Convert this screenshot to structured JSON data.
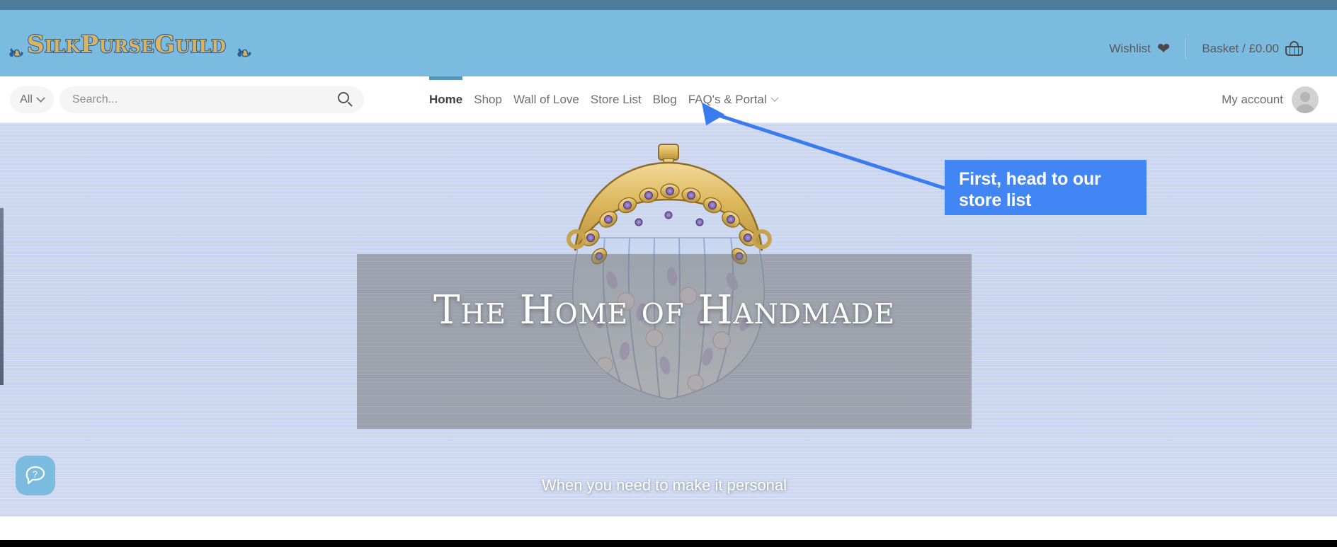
{
  "site": {
    "logo_text": "SilkPurseGuild",
    "logo_flourish_left": "❧",
    "logo_flourish_right": "❧"
  },
  "header": {
    "wishlist_label": "Wishlist",
    "wishlist_icon": "heart-icon",
    "basket_label": "Basket / £0.00",
    "basket_icon": "basket-icon"
  },
  "search": {
    "scope_label": "All",
    "scope_icon": "chevron-down-icon",
    "placeholder": "Search...",
    "value": "",
    "submit_icon": "search-icon"
  },
  "nav": {
    "items": [
      {
        "label": "Home",
        "active": true,
        "has_dropdown": false
      },
      {
        "label": "Shop",
        "active": false,
        "has_dropdown": false
      },
      {
        "label": "Wall of Love",
        "active": false,
        "has_dropdown": false
      },
      {
        "label": "Store List",
        "active": false,
        "has_dropdown": false
      },
      {
        "label": "Blog",
        "active": false,
        "has_dropdown": false
      },
      {
        "label": "FAQ's & Portal",
        "active": false,
        "has_dropdown": true
      }
    ]
  },
  "account": {
    "label": "My account",
    "avatar_icon": "user-avatar-icon"
  },
  "hero": {
    "title": "The Home of Handmade",
    "subtitle": "When you need to make it personal",
    "image_alt": "handmade-purse-illustration"
  },
  "help": {
    "icon": "question-chat-icon",
    "label": "?"
  },
  "annotation": {
    "text": "First, head to our store list",
    "line1": "First, head to our",
    "line2": "store list",
    "color": "#4285f4",
    "points_to": "Store List",
    "arrow_icon": "pointer-arrow-icon"
  },
  "colors": {
    "header_blue": "#7bbbdf",
    "top_strip_blue": "#4d7c9c",
    "nav_active_underline": "#5596bc",
    "hero_background": "#ccd6ef",
    "annotation_blue": "#4285f4"
  }
}
